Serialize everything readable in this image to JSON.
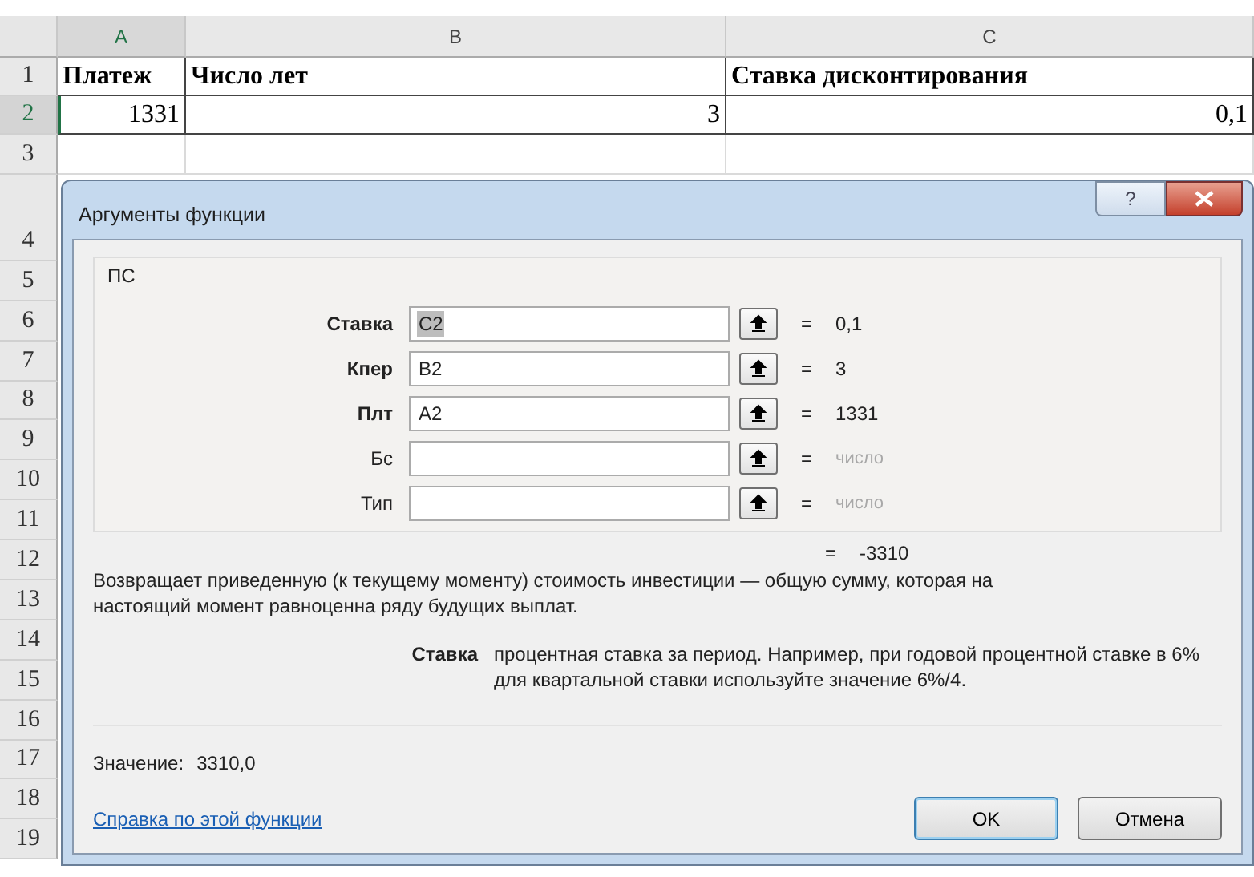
{
  "sheet": {
    "columns": [
      {
        "label": "A",
        "selected": true
      },
      {
        "label": "B",
        "selected": false
      },
      {
        "label": "C",
        "selected": false
      }
    ],
    "rows": [
      {
        "number": "1",
        "kind": "header",
        "selected": false,
        "cells": [
          "Платеж",
          "Число лет",
          "Ставка дисконтирования"
        ]
      },
      {
        "number": "2",
        "kind": "number",
        "selected": true,
        "cells": [
          "1331",
          "3",
          "0,1"
        ]
      },
      {
        "number": "3",
        "kind": "blank",
        "selected": false,
        "cells": []
      },
      {
        "number": "4",
        "kind": "tall",
        "selected": false,
        "cells": []
      },
      {
        "number": "5",
        "kind": "blank",
        "selected": false,
        "cells": []
      },
      {
        "number": "6",
        "kind": "blank",
        "selected": false,
        "cells": []
      },
      {
        "number": "7",
        "kind": "blank",
        "selected": false,
        "cells": []
      },
      {
        "number": "8",
        "kind": "blank",
        "selected": false,
        "cells": []
      },
      {
        "number": "9",
        "kind": "blank",
        "selected": false,
        "cells": []
      },
      {
        "number": "10",
        "kind": "blank",
        "selected": false,
        "cells": []
      },
      {
        "number": "11",
        "kind": "blank",
        "selected": false,
        "cells": []
      },
      {
        "number": "12",
        "kind": "blank",
        "selected": false,
        "cells": []
      },
      {
        "number": "13",
        "kind": "blank",
        "selected": false,
        "cells": []
      },
      {
        "number": "14",
        "kind": "blank",
        "selected": false,
        "cells": []
      },
      {
        "number": "15",
        "kind": "blank",
        "selected": false,
        "cells": []
      },
      {
        "number": "16",
        "kind": "blank",
        "selected": false,
        "cells": []
      },
      {
        "number": "17",
        "kind": "blank",
        "selected": false,
        "cells": []
      },
      {
        "number": "18",
        "kind": "blank",
        "selected": false,
        "cells": []
      },
      {
        "number": "19",
        "kind": "blank",
        "selected": false,
        "cells": []
      }
    ]
  },
  "dialog": {
    "title": "Аргументы функции",
    "help_button": "?",
    "function_name": "ПС",
    "arguments": [
      {
        "label": "Ставка",
        "required": true,
        "value": "C2",
        "highlighted": true,
        "result": "0,1",
        "greyed": false
      },
      {
        "label": "Кпер",
        "required": true,
        "value": "B2",
        "highlighted": false,
        "result": "3",
        "greyed": false
      },
      {
        "label": "Плт",
        "required": true,
        "value": "A2",
        "highlighted": false,
        "result": "1331",
        "greyed": false
      },
      {
        "label": "Бс",
        "required": false,
        "result": "число",
        "greyed": true
      },
      {
        "label": "Тип",
        "required": false,
        "result": "число",
        "greyed": true
      }
    ],
    "equals": "=",
    "formula_result": "-3310",
    "description": "Возвращает приведенную (к текущему моменту) стоимость инвестиции — общую сумму, которая на настоящий момент равноценна ряду будущих выплат.",
    "argument_help": {
      "name": "Ставка",
      "text": "процентная ставка за период. Например, при годовой процентной ставке в 6% для квартальной ставки используйте значение 6%/4."
    },
    "value_label": "Значение:",
    "value": "3310,0",
    "help_link": "Справка по этой функции",
    "buttons": [
      {
        "label": "OK",
        "default": true
      },
      {
        "label": "Отмена",
        "default": false
      }
    ]
  }
}
